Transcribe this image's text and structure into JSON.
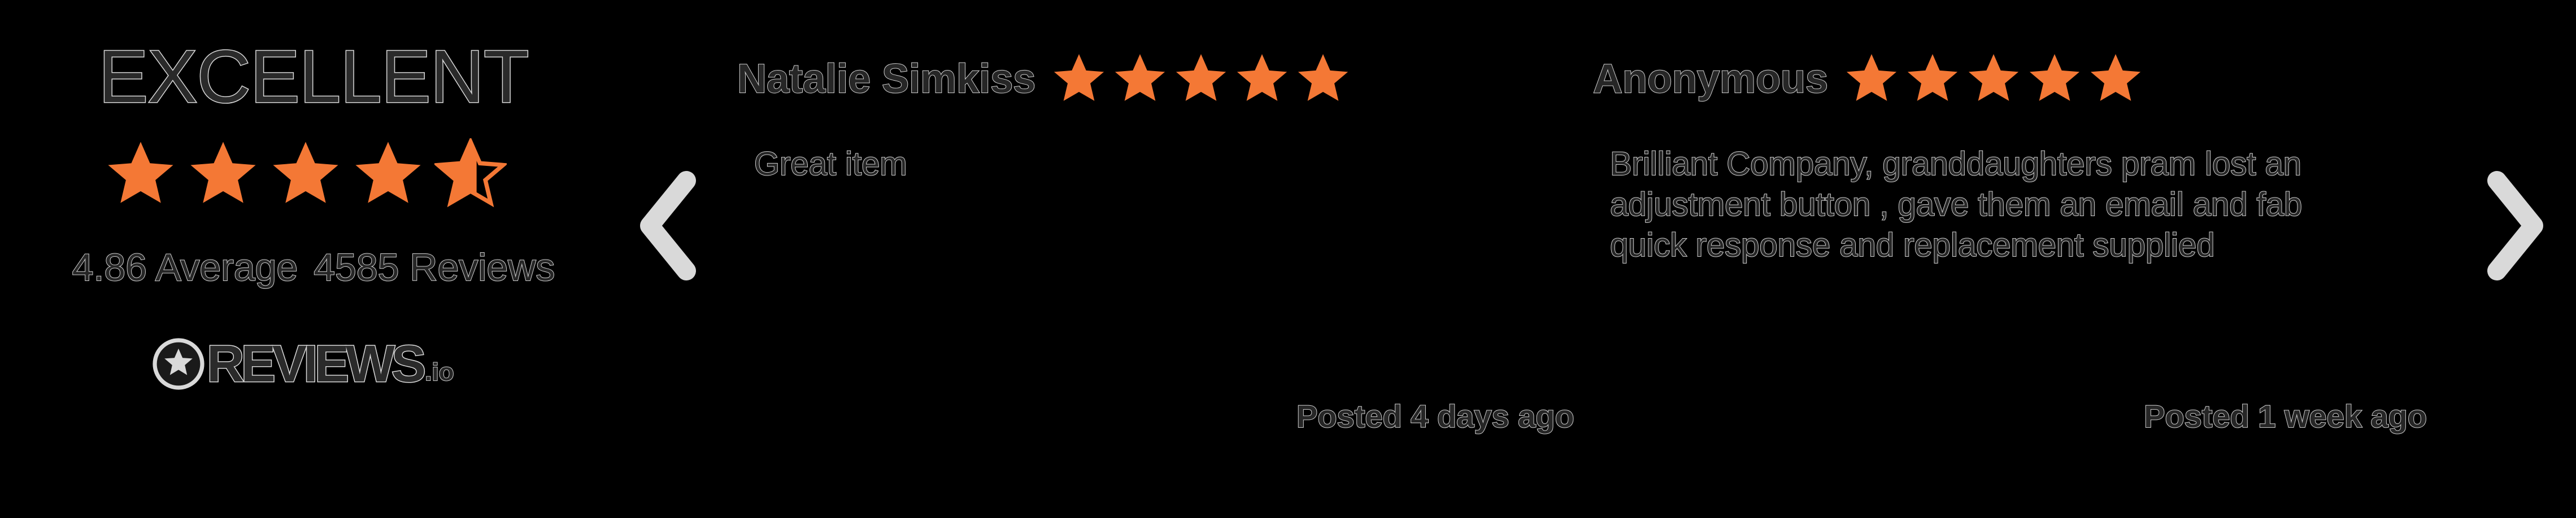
{
  "summary": {
    "rating_word": "EXCELLENT",
    "average_label": "4.86 Average",
    "reviews_count_label": "4585 Reviews",
    "rating_stars": 4.86,
    "logo_word": "REVIEWS",
    "logo_tld": ".io"
  },
  "navigation": {
    "prev_icon": "chevron-left-icon",
    "next_icon": "chevron-right-icon"
  },
  "reviews": [
    {
      "author": "Natalie Simkiss",
      "stars": 5,
      "lines": [
        "Great item"
      ],
      "posted": "Posted 4 days ago"
    },
    {
      "author": "Anonymous",
      "stars": 5,
      "lines": [
        "Brilliant Company, granddaughters pram lost an",
        "adjustment button , gave them an email and fab",
        "quick response and  replacement supplied"
      ],
      "posted": "Posted 1 week ago"
    }
  ],
  "colors": {
    "background": "#000000",
    "star": "#f47835",
    "text_fill": "#262626",
    "text_outline": "#d9d9d9"
  }
}
